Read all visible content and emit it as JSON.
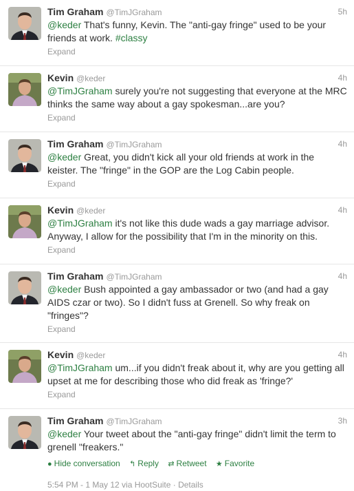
{
  "tweets": [
    {
      "name": "Tim Graham",
      "handle": "@TimJGraham",
      "time": "5h",
      "avatar": "tim-avatar-icon",
      "mention": "@keder",
      "text": " That's funny, Kevin. The \"anti-gay fringe\" used to be your friends at work. ",
      "hashtag": "#classy",
      "expand": "Expand"
    },
    {
      "name": "Kevin",
      "handle": "@keder",
      "time": "4h",
      "avatar": "kevin-avatar-icon",
      "mention": "@TimJGraham",
      "text": " surely you're not suggesting that everyone at the MRC thinks the same way about a gay spokesman...are you?",
      "expand": "Expand"
    },
    {
      "name": "Tim Graham",
      "handle": "@TimJGraham",
      "time": "4h",
      "avatar": "tim-avatar-icon",
      "mention": "@keder",
      "text": " Great, you didn't kick all your old friends at work in the keister. The \"fringe\" in the GOP are the Log Cabin people.",
      "expand": "Expand"
    },
    {
      "name": "Kevin",
      "handle": "@keder",
      "time": "4h",
      "avatar": "kevin-avatar-icon",
      "mention": "@TimJGraham",
      "text": " it's not like this dude wads a gay marriage advisor. Anyway, I allow for the possibility that I'm in the minority on this.",
      "expand": "Expand"
    },
    {
      "name": "Tim Graham",
      "handle": "@TimJGraham",
      "time": "4h",
      "avatar": "tim-avatar-icon",
      "mention": "@keder",
      "text": " Bush appointed a gay ambassador or two (and had a gay AIDS czar or two). So I didn't fuss at Grenell. So why freak on \"fringes\"?",
      "expand": "Expand"
    },
    {
      "name": "Kevin",
      "handle": "@keder",
      "time": "4h",
      "avatar": "kevin-avatar-icon",
      "mention": "@TimJGraham",
      "text": " um...if you didn't freak about it, why are you getting all upset at me for describing those who did freak as 'fringe?'",
      "expand": "Expand"
    },
    {
      "name": "Tim Graham",
      "handle": "@TimJGraham",
      "time": "3h",
      "avatar": "tim-avatar-icon",
      "mention": "@keder",
      "text": " Your tweet about the \"anti-gay fringe\" didn't limit the term to grenell \"freakers.\"",
      "actions": {
        "hide": "Hide conversation",
        "reply": "Reply",
        "retweet": "Retweet",
        "favorite": "Favorite"
      },
      "meta": "5:54 PM - 1 May 12 via HootSuite · Details"
    }
  ],
  "colors": {
    "link": "#2c7f41",
    "muted": "#999999",
    "text": "#333333",
    "divider": "#e6e6e6"
  }
}
